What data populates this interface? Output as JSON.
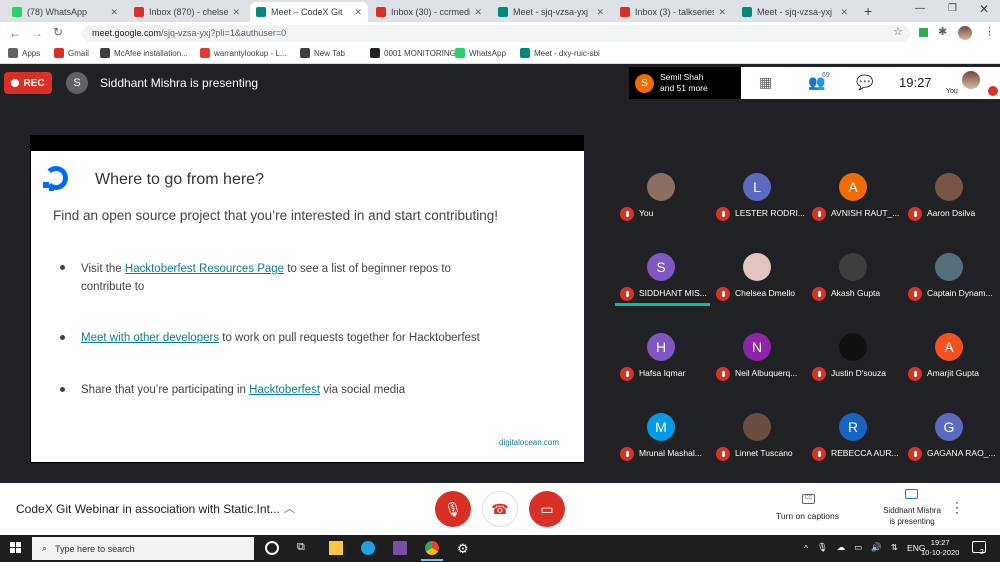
{
  "browser": {
    "tabs": [
      {
        "title": "(78) WhatsApp",
        "favicon_color": "#25d366",
        "active": false
      },
      {
        "title": "Inbox (870) - chelsead",
        "favicon_color": "#d93025",
        "active": false
      },
      {
        "title": "Meet – CodeX Git",
        "favicon_color": "#00897b",
        "active": true
      },
      {
        "title": "Inbox (30) - ccrmediat",
        "favicon_color": "#d93025",
        "active": false
      },
      {
        "title": "Meet - sjq-vzsa-yxj",
        "favicon_color": "#00897b",
        "active": false
      },
      {
        "title": "Inbox (3) - talkseriesm",
        "favicon_color": "#d93025",
        "active": false
      },
      {
        "title": "Meet - sjq-vzsa-yxj",
        "favicon_color": "#00897b",
        "active": false
      }
    ],
    "new_tab_label": "+",
    "url_host": "meet.google.com",
    "url_path": "/sjq-vzsa-yxj?pli=1&authuser=0",
    "bookmarks": [
      {
        "label": "Apps",
        "color": "#5f6368"
      },
      {
        "label": "Gmail",
        "color": "#d93025"
      },
      {
        "label": "McAfee installation...",
        "color": "#3c4043"
      },
      {
        "label": "warrantylookup - L...",
        "color": "#e53935"
      },
      {
        "label": "New Tab",
        "color": "#3c4043"
      },
      {
        "label": "0001 MONITORING...",
        "color": "#202124"
      },
      {
        "label": "WhatsApp",
        "color": "#25d366"
      },
      {
        "label": "Meet - dxy-ruic-sbi",
        "color": "#00897b"
      }
    ]
  },
  "meet": {
    "rec_label": "REC",
    "presenter_initial": "S",
    "presenting_text": "Siddhant Mishra is presenting",
    "active_speaker": {
      "initial": "S",
      "name": "Semil Shah",
      "more": "and 51 more"
    },
    "participant_count": "69",
    "clock": "19:27",
    "you_label": "You"
  },
  "slide": {
    "title": "Where to go from here?",
    "subtitle": "Find an open source project that you’re interested in and start contributing!",
    "b1_pre": "Visit the ",
    "b1_link": "Hacktoberfest Resources Page",
    "b1_post": " to see a list of beginner repos to",
    "b1_line2": "contribute to",
    "b2_link": "Meet with other developers",
    "b2_post": " to work on pull requests together for Hacktoberfest",
    "b3_pre": "Share that you’re participating in ",
    "b3_link": "Hacktoberfest",
    "b3_post": " via social media",
    "footer": "digitalocean.com"
  },
  "participants": [
    {
      "name": "You",
      "initial": "",
      "color": "#8d6e63"
    },
    {
      "name": "LESTER RODRI...",
      "initial": "L",
      "color": "#5c6bc0"
    },
    {
      "name": "AVNISH RAUT_...",
      "initial": "A",
      "color": "#ef6c00"
    },
    {
      "name": "Aaron Dsilva",
      "initial": "",
      "color": "#795548"
    },
    {
      "name": "SIDDHANT MIS...",
      "initial": "S",
      "color": "#7e57c2"
    },
    {
      "name": "Chelsea Dmello",
      "initial": "",
      "color": "#e0c4c0"
    },
    {
      "name": "Akash Gupta",
      "initial": "",
      "color": "#3e3e3e"
    },
    {
      "name": "Captain Dynam...",
      "initial": "",
      "color": "#546e7a"
    },
    {
      "name": "Hafsa Iqmar",
      "initial": "H",
      "color": "#7e57c2"
    },
    {
      "name": "Neil Albuquerq...",
      "initial": "N",
      "color": "#8e24aa"
    },
    {
      "name": "Justin D'souza",
      "initial": "",
      "color": "#111111"
    },
    {
      "name": "Amarjit Gupta",
      "initial": "A",
      "color": "#f4511e"
    },
    {
      "name": "Mrunal Mashal...",
      "initial": "M",
      "color": "#039be5"
    },
    {
      "name": "Linnet Tuscano",
      "initial": "",
      "color": "#6d4c41"
    },
    {
      "name": "REBECCA AUR...",
      "initial": "R",
      "color": "#1565c0"
    },
    {
      "name": "GAGANA RAO_...",
      "initial": "G",
      "color": "#5c6bc0"
    }
  ],
  "bottom": {
    "meeting_title": "CodeX Git Webinar in association with Static.Int...",
    "captions_icon_text": "CC",
    "captions_label": "Turn on captions",
    "presenting_label_1": "Siddhant Mishra",
    "presenting_label_2": "is presenting"
  },
  "taskbar": {
    "search_placeholder": "Type here to search",
    "language": "ENG",
    "time": "19:27",
    "date": "10-10-2020",
    "notification_count": "2"
  }
}
